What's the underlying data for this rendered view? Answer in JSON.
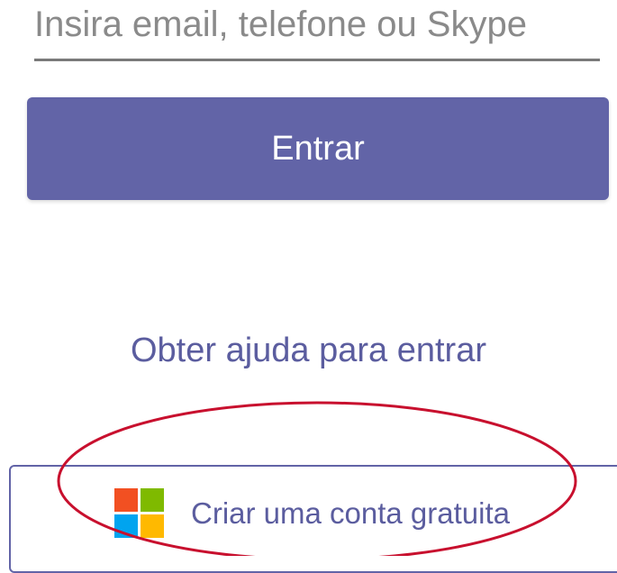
{
  "email": {
    "placeholder": "Insira email, telefone ou Skype",
    "value": ""
  },
  "signin": {
    "label": "Entrar",
    "color": "#6264a7"
  },
  "help": {
    "label": "Obter ajuda para entrar"
  },
  "create_account": {
    "label": "Criar uma conta gratuita",
    "icon": "microsoft-logo-icon",
    "logo_colors": [
      "#f25022",
      "#7fba00",
      "#00a4ef",
      "#ffb900"
    ]
  },
  "annotation": {
    "shape": "ellipse",
    "color": "#c8102e"
  }
}
